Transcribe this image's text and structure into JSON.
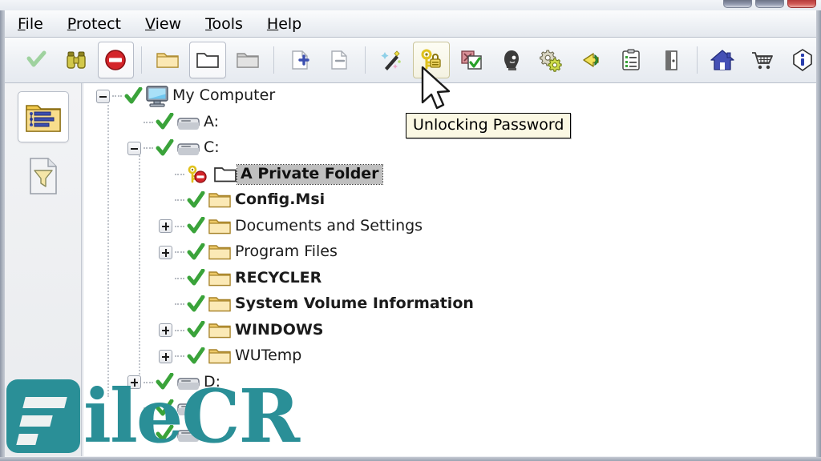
{
  "window": {
    "controls": [
      {
        "name": "minimize-button",
        "label": ""
      },
      {
        "name": "maximize-button",
        "label": ""
      },
      {
        "name": "close-button",
        "label": ""
      }
    ]
  },
  "menubar": {
    "items": [
      {
        "name": "menu-file",
        "pre": "",
        "accel": "F",
        "post": "ile"
      },
      {
        "name": "menu-protect",
        "pre": "",
        "accel": "P",
        "post": "rotect"
      },
      {
        "name": "menu-view",
        "pre": "",
        "accel": "V",
        "post": "iew"
      },
      {
        "name": "menu-tools",
        "pre": "",
        "accel": "T",
        "post": "ools"
      },
      {
        "name": "menu-help",
        "pre": "",
        "accel": "H",
        "post": "elp"
      }
    ]
  },
  "toolbar": {
    "buttons": [
      {
        "name": "toolbar-check-button",
        "icon": "check-icon",
        "state": "disabled"
      },
      {
        "name": "toolbar-find-button",
        "icon": "binoculars-icon",
        "state": "normal"
      },
      {
        "name": "toolbar-stop-button",
        "icon": "stop-icon",
        "state": "framed"
      },
      {
        "name": "toolbar-folder-open-button",
        "icon": "folder-yellow-icon",
        "state": "normal"
      },
      {
        "name": "toolbar-folder-white-button",
        "icon": "folder-white-icon",
        "state": "framed"
      },
      {
        "name": "toolbar-folder-gray-button",
        "icon": "folder-gray-icon",
        "state": "normal"
      },
      {
        "name": "toolbar-file-add-button",
        "icon": "file-add-icon",
        "state": "normal"
      },
      {
        "name": "toolbar-file-remove-button",
        "icon": "file-remove-icon",
        "state": "normal"
      },
      {
        "name": "toolbar-wizard-button",
        "icon": "magic-wand-icon",
        "state": "normal"
      },
      {
        "name": "toolbar-unlocking-password-button",
        "icon": "key-lock-icon",
        "state": "hover"
      },
      {
        "name": "toolbar-approve-button",
        "icon": "checkbox-green-icon",
        "state": "normal"
      },
      {
        "name": "toolbar-user-button",
        "icon": "user-head-icon",
        "state": "normal"
      },
      {
        "name": "toolbar-settings-button",
        "icon": "gears-icon",
        "state": "normal"
      },
      {
        "name": "toolbar-exit-arrow-button",
        "icon": "arrow-exit-icon",
        "state": "normal"
      },
      {
        "name": "toolbar-list-button",
        "icon": "clipboard-list-icon",
        "state": "normal"
      },
      {
        "name": "toolbar-logoff-button",
        "icon": "door-exit-icon",
        "state": "normal"
      },
      {
        "name": "toolbar-home-button",
        "icon": "home-icon",
        "state": "normal"
      },
      {
        "name": "toolbar-buy-button",
        "icon": "cart-icon",
        "state": "normal"
      },
      {
        "name": "toolbar-about-button",
        "icon": "info-icon",
        "state": "normal"
      }
    ]
  },
  "sidebar": {
    "items": [
      {
        "name": "sidebar-item-protected-list",
        "icon": "folder-list-icon",
        "state": "selected"
      },
      {
        "name": "sidebar-item-filter",
        "icon": "filter-page-icon",
        "state": "normal"
      }
    ]
  },
  "tooltip": {
    "text": "Unlocking Password"
  },
  "tree": {
    "nodes": [
      {
        "label": "My Computer",
        "icon": "computer-icon",
        "status": "check",
        "expander": "minus",
        "depth": 0,
        "bold": false,
        "selected": false
      },
      {
        "label": "A:",
        "icon": "drive-icon",
        "status": "check",
        "expander": "none",
        "depth": 1,
        "bold": false,
        "selected": false
      },
      {
        "label": "C:",
        "icon": "drive-icon",
        "status": "check",
        "expander": "minus",
        "depth": 1,
        "bold": false,
        "selected": false
      },
      {
        "label": "A Private Folder",
        "icon": "folder-empty-icon",
        "status": "key-stop",
        "expander": "none",
        "depth": 2,
        "bold": true,
        "selected": true
      },
      {
        "label": "Config.Msi",
        "icon": "folder-icon",
        "status": "check",
        "expander": "none",
        "depth": 2,
        "bold": true,
        "selected": false
      },
      {
        "label": "Documents and Settings",
        "icon": "folder-icon",
        "status": "check",
        "expander": "plus",
        "depth": 2,
        "bold": false,
        "selected": false
      },
      {
        "label": "Program Files",
        "icon": "folder-icon",
        "status": "check",
        "expander": "plus",
        "depth": 2,
        "bold": false,
        "selected": false
      },
      {
        "label": "RECYCLER",
        "icon": "folder-icon",
        "status": "check",
        "expander": "none",
        "depth": 2,
        "bold": true,
        "selected": false
      },
      {
        "label": "System Volume Information",
        "icon": "folder-icon",
        "status": "check",
        "expander": "none",
        "depth": 2,
        "bold": true,
        "selected": false
      },
      {
        "label": "WINDOWS",
        "icon": "folder-icon",
        "status": "check",
        "expander": "plus",
        "depth": 2,
        "bold": true,
        "selected": false
      },
      {
        "label": "WUTemp",
        "icon": "folder-icon",
        "status": "check",
        "expander": "plus",
        "depth": 2,
        "bold": false,
        "selected": false
      },
      {
        "label": "D:",
        "icon": "drive-icon",
        "status": "check",
        "expander": "plus",
        "depth": 1,
        "bold": false,
        "selected": false
      },
      {
        "label": "",
        "icon": "drive-icon",
        "status": "check",
        "expander": "none",
        "depth": 1,
        "bold": false,
        "selected": false
      },
      {
        "label": "",
        "icon": "drive-icon",
        "status": "check",
        "expander": "none",
        "depth": 1,
        "bold": false,
        "selected": false
      }
    ]
  },
  "watermark": {
    "text": "ileCR",
    "color": "#2a8f97"
  },
  "colors": {
    "check_green": "#3aa33a",
    "stop_red": "#d4252a",
    "key_yellow": "#e8c72a",
    "folder_yellow": "#f0cd6a",
    "accent_blue": "#3b4fb0",
    "selection_gray": "#bfbfbf",
    "tooltip_bg": "#fbf8e3"
  }
}
